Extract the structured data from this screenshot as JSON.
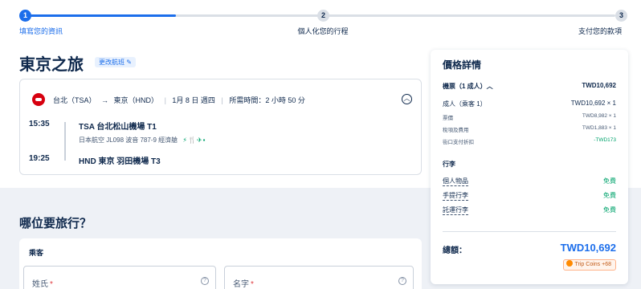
{
  "progress": {
    "steps": [
      {
        "number": "1",
        "label": "填寫您的資訊"
      },
      {
        "number": "2",
        "label": "個人化您的行程"
      },
      {
        "number": "3",
        "label": "支付您的款項"
      }
    ],
    "completed_fraction": 0.255
  },
  "trip": {
    "title": "東京之旅",
    "change_link": "更改航班 ✎"
  },
  "flight": {
    "origin": "台北（TSA）",
    "arrow": "→",
    "destination": "東京（HND）",
    "date": "1月 8 日 週四",
    "duration": "所需時間：2 小時 50 分",
    "dep_time": "15:35",
    "dep_place": "TSA 台北松山機場 T1",
    "flight_info": "日本航空  JL098  波音 787-9  經濟艙",
    "amenities": "⚡🍴✈▪",
    "arr_time": "19:25",
    "arr_place": "HND 東京 羽田機場 T3",
    "collapse_icon": "chevron-up-icon"
  },
  "who": {
    "title": "哪位要旅行？",
    "passenger_label": "乘客",
    "surname_label": "姓氏",
    "given_label": "名字",
    "required_mark": "*",
    "help_glyph": "?"
  },
  "price": {
    "title": "價格詳情",
    "ticket_label": "機票（1 成人）︿",
    "ticket_value": "TWD10,692",
    "adult_label": "成人（乘客 1）",
    "adult_value": "TWD10,692 × 1",
    "fare_label": "票價",
    "fare_value": "TWD8,982 × 1",
    "tax_label": "稅項及費用",
    "tax_value": "TWD1,883 × 1",
    "discount_label": "街口支付折扣",
    "discount_value": "-TWD173",
    "baggage_title": "行李",
    "personal_label": "個人物品",
    "personal_value": "免費",
    "carryon_label": "手提行李",
    "carryon_value": "免費",
    "checked_label": "託運行李",
    "checked_value": "免費",
    "total_label": "總額：",
    "total_value": "TWD10,692",
    "coins": "Trip Coins +68"
  },
  "colors": {
    "accent": "#1c6eeb",
    "free": "#00a36c",
    "text": "#0f294d",
    "background": "#eef1f6"
  }
}
